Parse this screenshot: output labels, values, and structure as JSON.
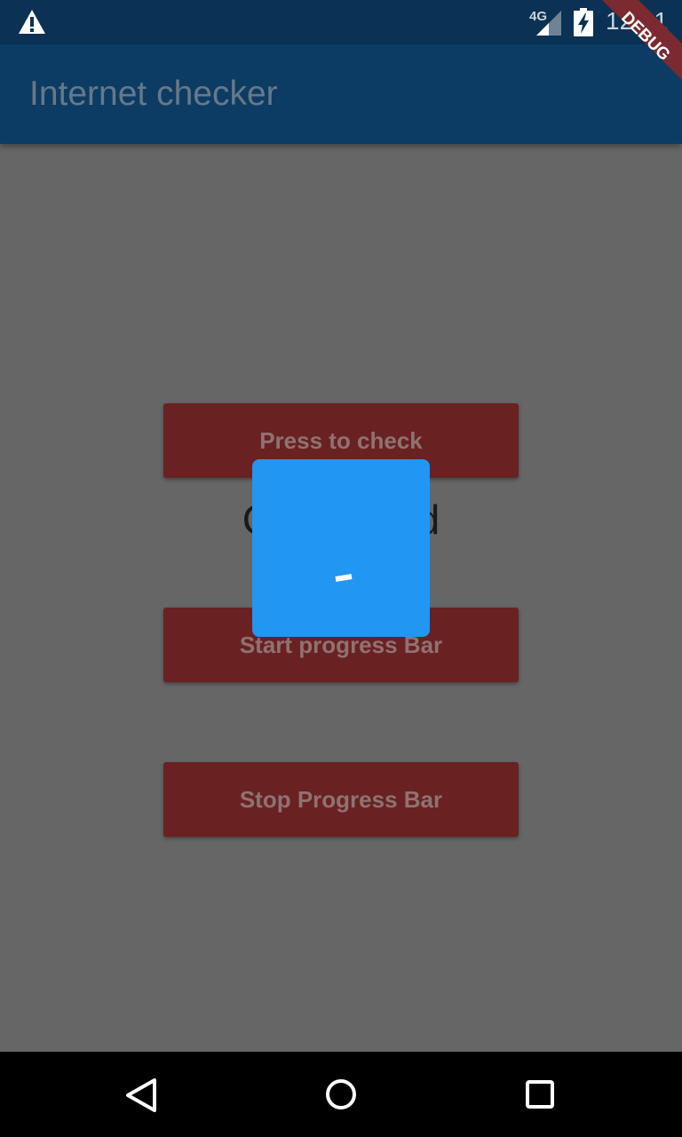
{
  "status_bar": {
    "network": "4G",
    "time": "12:31"
  },
  "app_bar": {
    "title": "Internet checker"
  },
  "buttons": {
    "check": "Press to check",
    "start_progress": "Start progress Bar",
    "stop_progress": "Stop Progress Bar"
  },
  "connection_status": "Connected",
  "debug_banner": "DEBUG",
  "icons": {
    "warning": "warning-icon",
    "signal": "cell-signal-icon",
    "battery": "battery-charging-icon",
    "back": "back-icon",
    "home": "home-icon",
    "recents": "recents-icon"
  },
  "colors": {
    "status_bar": "#0b3154",
    "app_bar": "#0c3c63",
    "scrim_background": "#666666",
    "button": "#6a2121",
    "dialog": "#2196f3",
    "debug_banner": "#7a2a30"
  }
}
